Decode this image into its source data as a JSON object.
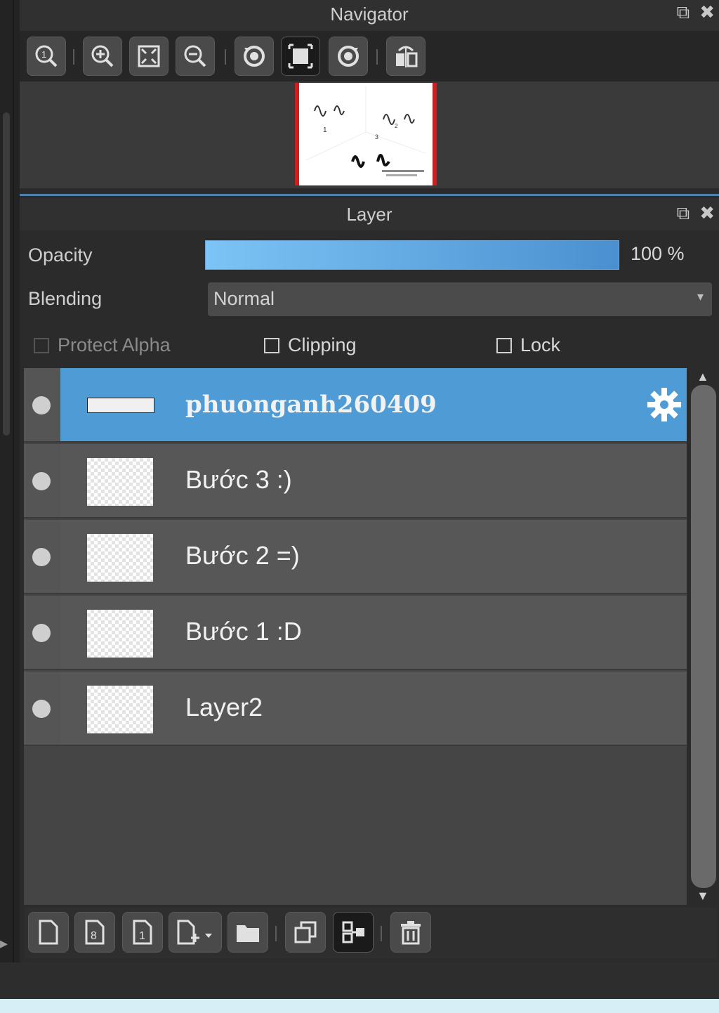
{
  "navigator": {
    "title": "Navigator",
    "toolbar": [
      {
        "icon": "zoom-actual-icon"
      },
      {
        "icon": "zoom-in-icon"
      },
      {
        "icon": "fit-screen-icon"
      },
      {
        "icon": "zoom-out-icon"
      },
      {
        "icon": "rotate-left-icon"
      },
      {
        "icon": "fit-window-icon",
        "active": true
      },
      {
        "icon": "rotate-right-icon"
      },
      {
        "icon": "flip-horizontal-icon"
      }
    ]
  },
  "layer_panel": {
    "title": "Layer",
    "opacity_label": "Opacity",
    "opacity_value": "100 %",
    "opacity_fraction": 1.0,
    "blending_label": "Blending",
    "blending_value": "Normal",
    "protect_alpha_label": "Protect Alpha",
    "clipping_label": "Clipping",
    "lock_label": "Lock",
    "layers": [
      {
        "name": "phuonganh260409",
        "selected": true
      },
      {
        "name": "Bước 3 :)"
      },
      {
        "name": "Bước 2 =)"
      },
      {
        "name": "Bước 1 :D"
      },
      {
        "name": "Layer2"
      }
    ]
  },
  "bottom_toolbar": [
    {
      "icon": "new-layer-icon"
    },
    {
      "icon": "new-8bit-layer-icon"
    },
    {
      "icon": "new-1bit-layer-icon"
    },
    {
      "icon": "add-layer-menu-icon"
    },
    {
      "icon": "folder-icon"
    },
    {
      "icon": "duplicate-layer-icon"
    },
    {
      "icon": "merge-layer-icon"
    },
    {
      "icon": "delete-layer-icon"
    }
  ],
  "colors": {
    "accent": "#4f9bd6",
    "panel": "#2b2b2b",
    "row": "#575757"
  }
}
